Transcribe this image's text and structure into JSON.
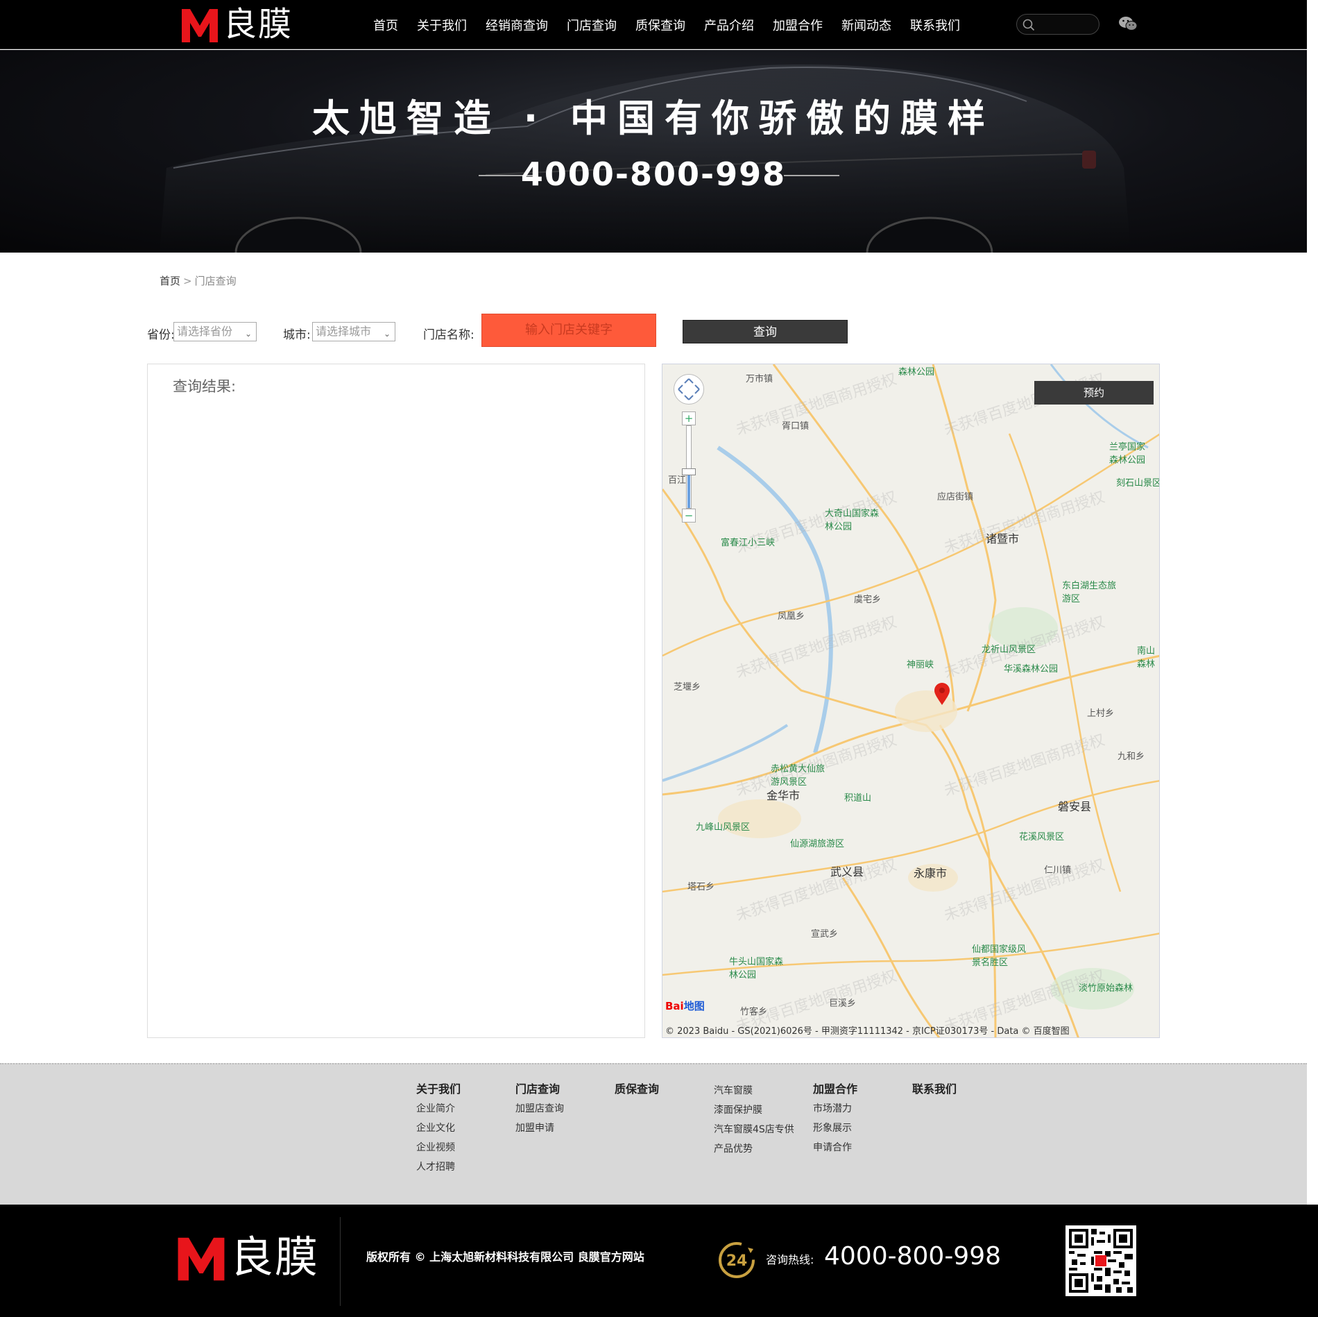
{
  "brand": {
    "name": "良膜",
    "accent": "#e8151b"
  },
  "nav": [
    "首页",
    "关于我们",
    "经销商查询",
    "门店查询",
    "质保查询",
    "产品介绍",
    "加盟合作",
    "新闻动态",
    "联系我们"
  ],
  "search": {
    "placeholder": ""
  },
  "banner": {
    "title": "太旭智造 · 中国有你骄傲的膜样",
    "phone": "4000-800-998"
  },
  "breadcrumb": {
    "home": "首页",
    "sep": ">",
    "current": "门店查询"
  },
  "filters": {
    "province_label": "省份:",
    "province_placeholder": "请选择省份",
    "city_label": "城市:",
    "city_placeholder": "请选择城市",
    "store_label": "门店名称:",
    "store_placeholder": "输入门店关键字",
    "query_button": "查询"
  },
  "results": {
    "title": "查询结果:"
  },
  "map": {
    "booking": "预约",
    "zoom_in": "+",
    "zoom_out": "−",
    "watermark": "未获得百度地图商用授权",
    "copyright": "© 2023 Baidu - GS(2021)6026号 - 甲测资字11111342 - 京ICP证030173号 - Data © 百度智图",
    "logo": {
      "a": "Bai",
      "b": "地图"
    },
    "labels": {
      "l1": "万市镇",
      "l2": "森林公园",
      "l3": "胥口镇",
      "l4": "兰亭国家森林公园",
      "l5": "刻石山景区",
      "l6": "大奇山国家森林公园",
      "l7": "富春江小三峡",
      "l8": "应店街镇",
      "l9": "诸暨市",
      "l10": "百江",
      "l11": "东白湖生态旅游区",
      "l12": "虞宅乡",
      "l13": "凤凰乡",
      "l14": "龙祈山风景区",
      "l15": "神丽峡",
      "l16": "华溪森林公园",
      "l17": "南山森林",
      "l18": "芝堰乡",
      "l19": "上村乡",
      "l20": "九和乡",
      "l21": "赤松黄大仙旅游风景区",
      "l22": "金华市",
      "l23": "积道山",
      "l24": "磐安县",
      "l25": "九峰山风景区",
      "l26": "仙源湖旅游区",
      "l27": "花溪风景区",
      "l28": "武义县",
      "l29": "永康市",
      "l30": "仁川镇",
      "l31": "塔石乡",
      "l32": "宣武乡",
      "l33": "牛头山国家森林公园",
      "l34": "仙都国家级风景名胜区",
      "l35": "淡竹原始森林",
      "l36": "竹客乡",
      "l37": "巨溪乡"
    }
  },
  "footer": {
    "cols": [
      {
        "head": "关于我们",
        "items": [
          "企业简介",
          "企业文化",
          "企业视频",
          "人才招聘"
        ]
      },
      {
        "head": "门店查询",
        "items": [
          "加盟店查询",
          "加盟申请"
        ]
      },
      {
        "head": "质保查询",
        "items": []
      },
      {
        "head": "",
        "items": [
          "汽车窗膜",
          "漆面保护膜",
          "汽车窗膜4S店专供",
          "产品优势"
        ]
      },
      {
        "head": "加盟合作",
        "items": [
          "市场潜力",
          "形象展示",
          "申请合作"
        ]
      },
      {
        "head": "联系我们",
        "items": []
      }
    ],
    "copyright": "版权所有 © 上海太旭新材料科技有限公司 良膜官方网站",
    "badge": "24",
    "hotline_label": "咨询热线:",
    "hotline": "4000-800-998"
  }
}
